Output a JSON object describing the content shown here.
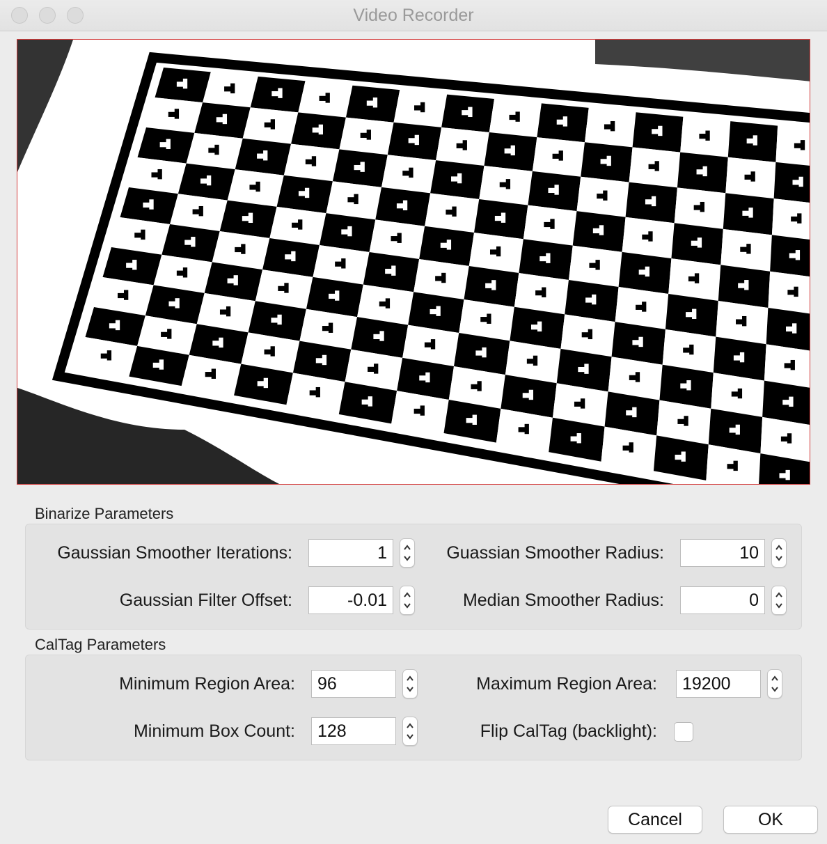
{
  "window": {
    "title": "Video Recorder"
  },
  "binarize": {
    "group_label": "Binarize Parameters",
    "gaussian_iterations": {
      "label": "Gaussian Smoother Iterations:",
      "value": "1"
    },
    "gaussian_radius": {
      "label": "Guassian Smoother Radius:",
      "value": "10"
    },
    "gaussian_offset": {
      "label": "Gaussian Filter Offset:",
      "value": "-0.01"
    },
    "median_radius": {
      "label": "Median Smoother Radius:",
      "value": "0"
    }
  },
  "caltag": {
    "group_label": "CalTag Parameters",
    "min_region_area": {
      "label": "Minimum Region Area:",
      "value": "96"
    },
    "max_region_area": {
      "label": "Maximum Region Area:",
      "value": "19200"
    },
    "min_box_count": {
      "label": "Minimum Box Count:",
      "value": "128"
    },
    "flip_caltag": {
      "label": "Flip CalTag (backlight):",
      "checked": false
    }
  },
  "buttons": {
    "cancel": "Cancel",
    "ok": "OK"
  },
  "preview": {
    "description_icon": "binarized-checkerboard-image"
  },
  "colors": {
    "preview_border": "#d23a3a",
    "window_bg": "#ececec"
  }
}
